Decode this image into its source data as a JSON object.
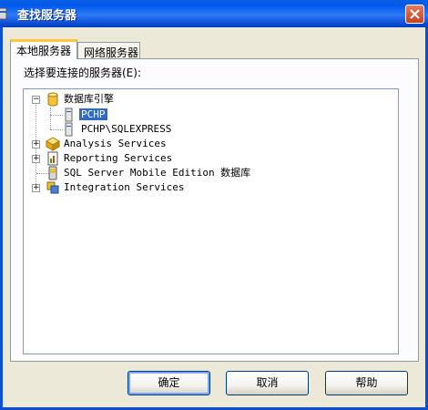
{
  "window": {
    "title": "查找服务器"
  },
  "tabs": [
    {
      "label": "本地服务器"
    },
    {
      "label": "网络服务器"
    }
  ],
  "panel": {
    "prompt": "选择要连接的服务器(E):"
  },
  "tree": {
    "database_engine": "数据库引擎",
    "servers": [
      "PCHP",
      "PCHP\\SQLEXPRESS"
    ],
    "analysis": "Analysis Services",
    "reporting": "Reporting Services",
    "mobile": "SQL Server Mobile Edition 数据库",
    "integration": "Integration Services",
    "selected": "PCHP"
  },
  "buttons": {
    "ok": "确定",
    "cancel": "取消",
    "help": "帮助"
  },
  "icons": {
    "app": "database-icon",
    "close": "close-icon",
    "engine": "database-cylinder-icon",
    "server": "server-icon",
    "analysis": "cube-icon",
    "reporting": "report-icon",
    "mobile": "mobile-database-icon",
    "integration": "integration-icon"
  }
}
